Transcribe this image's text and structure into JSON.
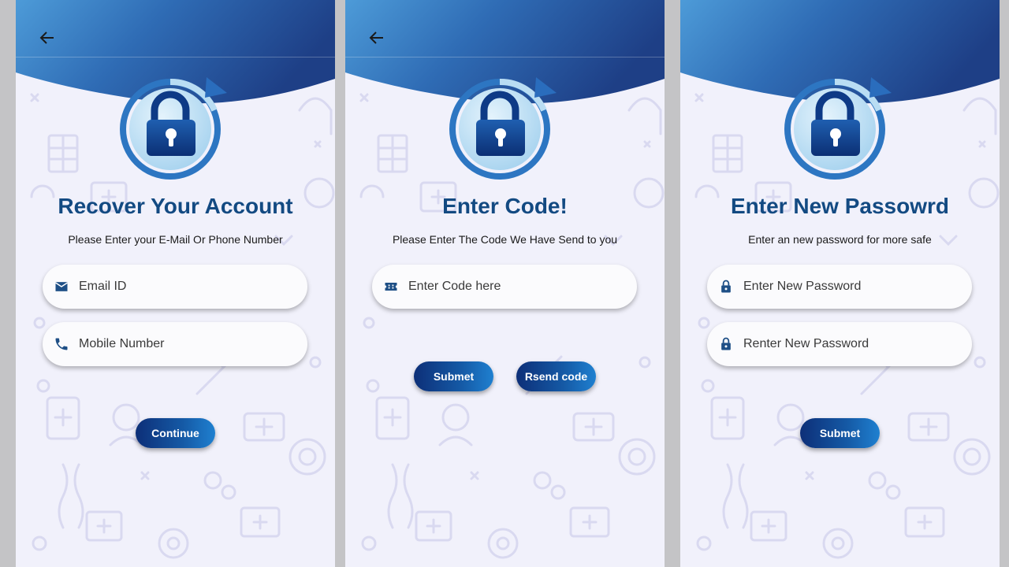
{
  "screens": [
    {
      "title": "Recover Your Account",
      "subtitle": "Please Enter your E-Mail Or Phone Number",
      "fields": [
        {
          "icon": "mail-icon",
          "placeholder": "Email ID"
        },
        {
          "icon": "phone-icon",
          "placeholder": "Mobile Number"
        }
      ],
      "buttons": [
        "Continue"
      ]
    },
    {
      "title": "Enter Code!",
      "subtitle": "Please Enter The Code We Have Send to you",
      "fields": [
        {
          "icon": "ticket-icon",
          "placeholder": "Enter Code here"
        }
      ],
      "buttons": [
        "Submet",
        "Rsend code"
      ]
    },
    {
      "title": "Enter New Passowrd",
      "subtitle": "Enter an new password for more safe",
      "fields": [
        {
          "icon": "lock-icon",
          "placeholder": "Enter New Password"
        },
        {
          "icon": "lock-icon",
          "placeholder": "Renter New Password"
        }
      ],
      "buttons": [
        "Submet"
      ]
    }
  ],
  "colors": {
    "header_dark": "#1e3f86",
    "header_light": "#4d9bd8",
    "title": "#134a82",
    "background": "#f1f1fb",
    "icon": "#1e4f86"
  },
  "icons": {
    "back": "arrow-left-icon",
    "hero": "lock-refresh-icon"
  }
}
